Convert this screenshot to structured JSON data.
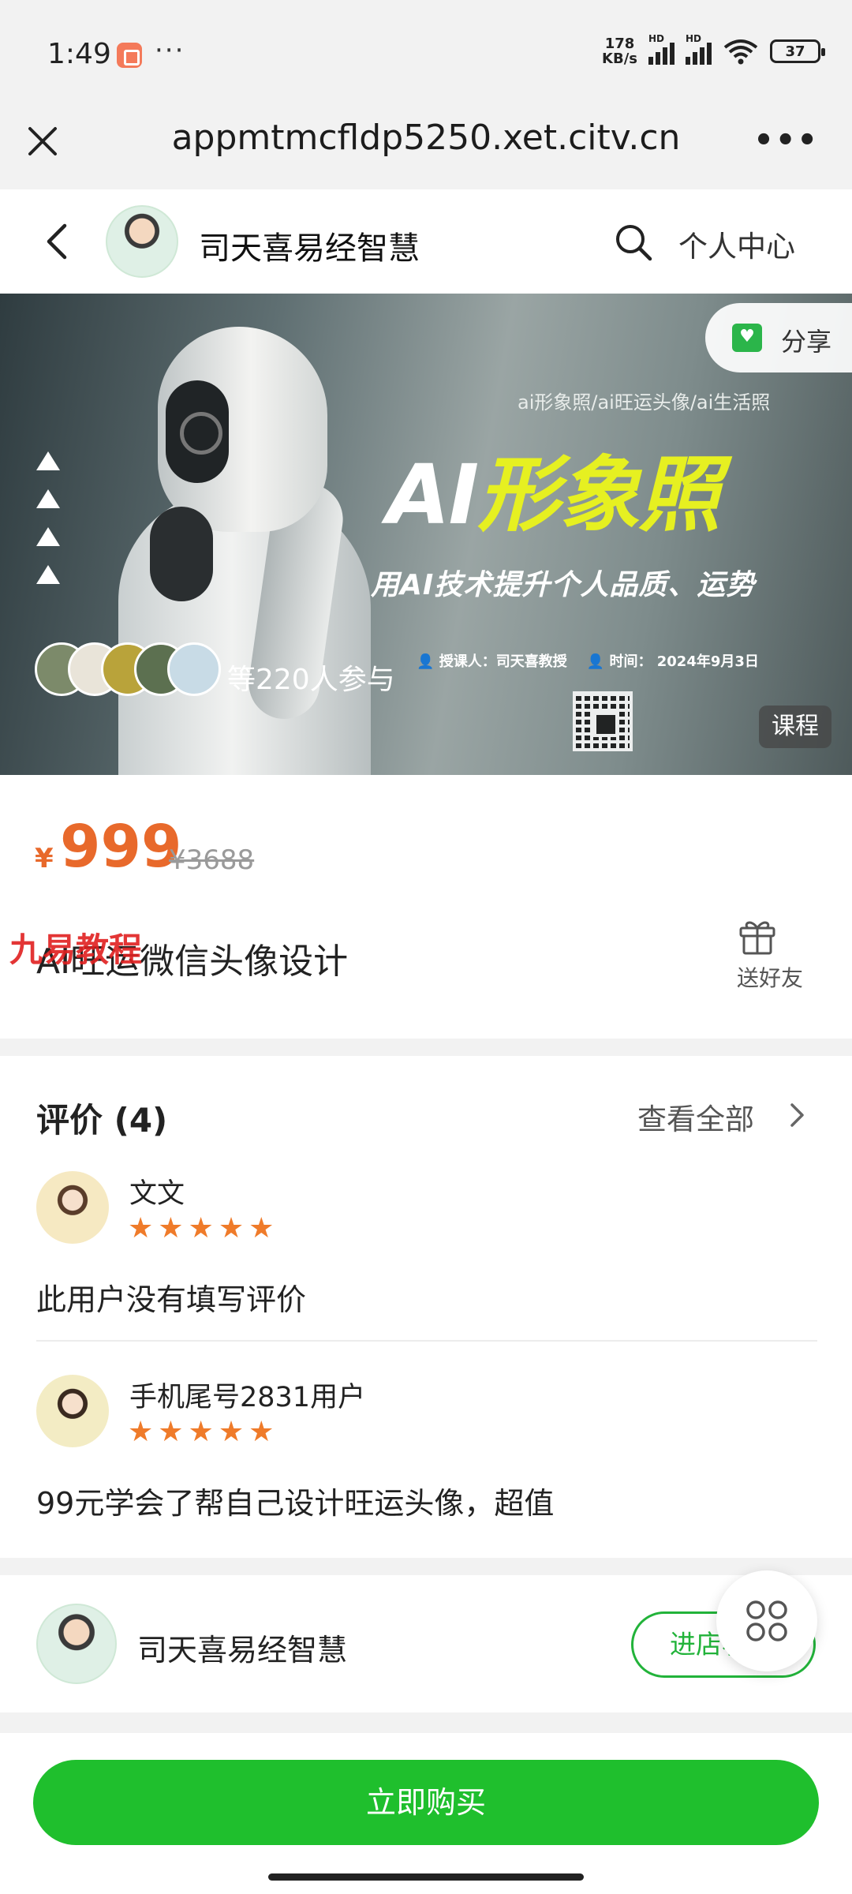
{
  "status_bar": {
    "time": "1:49",
    "more_dots": "···",
    "net_speed_value": "178",
    "net_speed_unit": "KB/s",
    "signal_tag": "HD",
    "battery": "37"
  },
  "browser": {
    "url": "appmtmcfldp5250.xet.citv.cn",
    "more": "•••"
  },
  "shop_header": {
    "shop_name": "司天喜易经智慧",
    "personal_center": "个人中心"
  },
  "banner": {
    "share_label": "分享",
    "subtitle": "ai形象照/ai旺运头像/ai生活照",
    "title_ai": "AI",
    "title_rest": "形象照",
    "slogan": "用AI技术提升个人品质、运势",
    "lecturer": "授课人：司天喜教授",
    "time": "时间： 2024年9月3日",
    "participants_text": "等220人参与",
    "course_tag": "课程"
  },
  "product": {
    "currency": "¥",
    "price": "999",
    "original_price": "¥3688",
    "title": "AI旺运微信头像设计",
    "watermark": "九易教程",
    "gift_label": "送好友"
  },
  "reviews": {
    "heading": "评价 (4)",
    "view_all": "查看全部",
    "items": [
      {
        "name": "文文",
        "stars": "★★★★★",
        "text": "此用户没有填写评价"
      },
      {
        "name": "手机尾号2831用户",
        "stars": "★★★★★",
        "text": "99元学会了帮自己设计旺运头像，超值"
      }
    ]
  },
  "shop_card": {
    "name": "司天喜易经智慧",
    "enter_button": "进店看看"
  },
  "bottom": {
    "buy_button": "立即购买"
  },
  "colors": {
    "brand_green": "#1fbf2d",
    "price_orange": "#e8692b",
    "star_orange": "#ef7b2a",
    "banner_title_yellow": "#e6f021"
  }
}
